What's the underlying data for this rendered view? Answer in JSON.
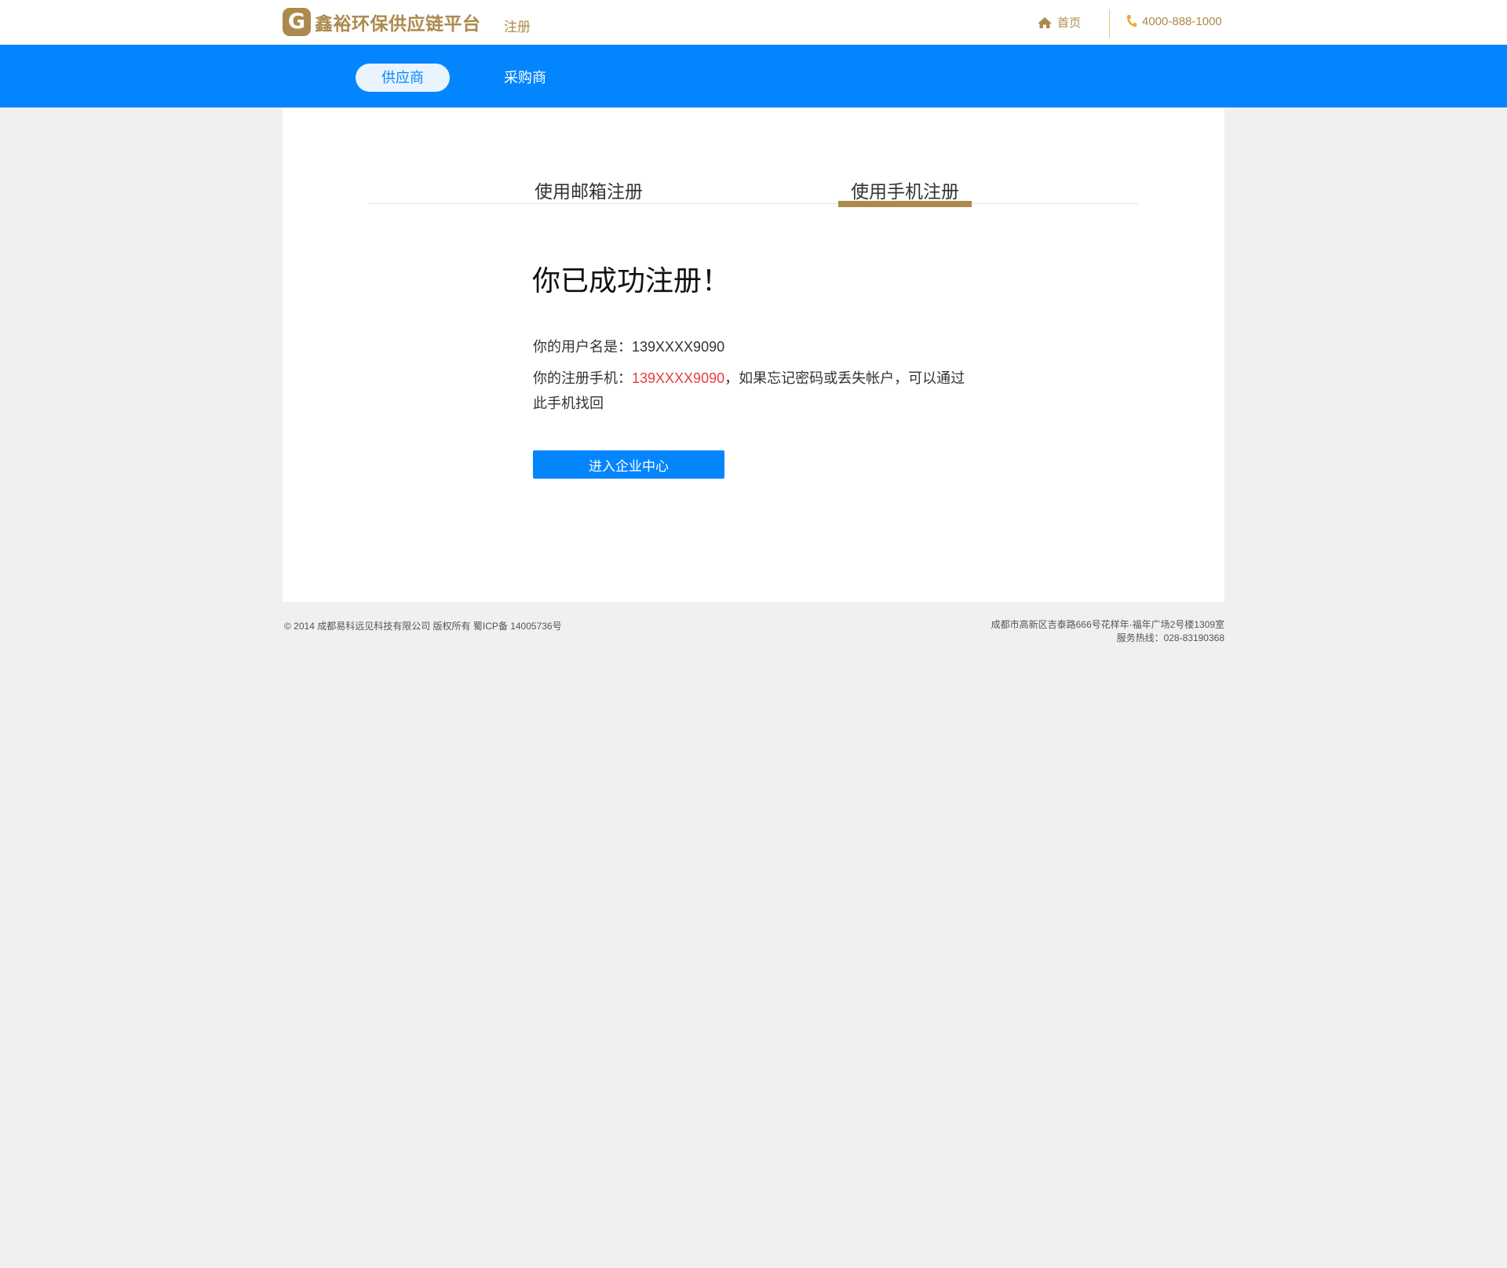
{
  "header": {
    "logo_letter": "G",
    "logo_text": "鑫裕环保供应链平台",
    "page_label": "注册",
    "home_label": "首页",
    "phone": "4000-888-1000",
    "home_icon": "home-icon",
    "phone_icon": "phone-icon",
    "brand_color": "#ac8a4e"
  },
  "nav": {
    "active_tab": "供应商",
    "other_tab": "采购商",
    "band_color": "#0385fd"
  },
  "register": {
    "tabs": [
      "使用邮箱注册",
      "使用手机注册"
    ],
    "active_tab": "使用手机注册",
    "title": "你已成功注册！",
    "username_label": "你的用户名是：",
    "username": "139XXXX9090",
    "phone_label": "你的注册手机：",
    "phone": "139XXXX9090",
    "phone_note": "，如果忘记密码或丢失帐户，可以通过此手机找回",
    "enter_button": "进入企业中心",
    "highlight_color": "#ea3b3b"
  },
  "footer": {
    "copyright": "© 2014 成都易科远见科技有限公司 版权所有 蜀ICP备 14005736号",
    "address": "成都市高新区吉泰路666号花样年·福年广场2号楼1309室",
    "service": "服务热线：028-83190368"
  }
}
